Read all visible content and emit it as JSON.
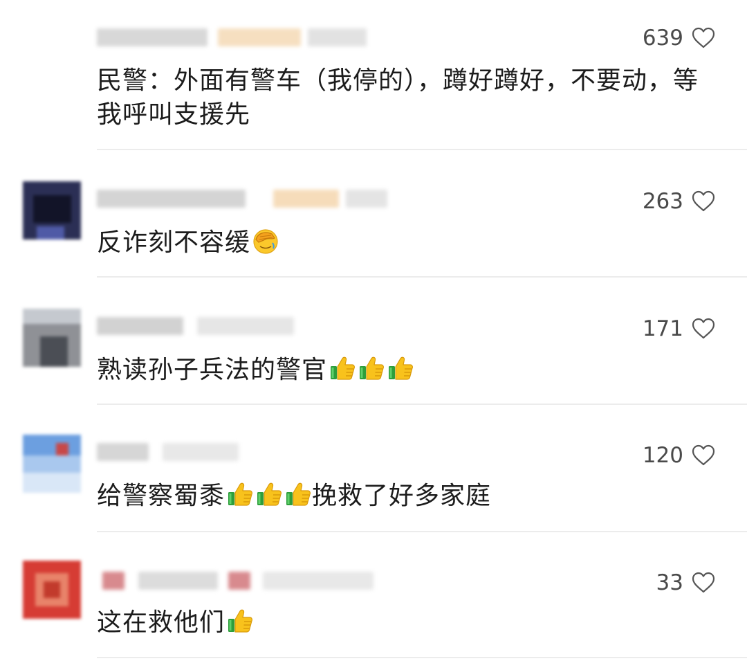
{
  "comments": [
    {
      "likes": "639",
      "text": "民警：外面有警车（我停的），蹲好蹲好，不要动，等我呼叫支援先",
      "emojis": []
    },
    {
      "likes": "263",
      "text": "反诈刻不容缓",
      "emojis": [
        "facepalm-emoji"
      ]
    },
    {
      "likes": "171",
      "text": "熟读孙子兵法的警官",
      "emojis": [
        "thumbs-up-emoji",
        "thumbs-up-emoji",
        "thumbs-up-emoji"
      ]
    },
    {
      "likes": "120",
      "text_before": "给警察蜀黍",
      "text_after": "挽救了好多家庭",
      "emojis": [
        "thumbs-up-emoji",
        "thumbs-up-emoji",
        "thumbs-up-emoji"
      ]
    },
    {
      "likes": "33",
      "text": "这在救他们",
      "emojis": [
        "thumbs-up-emoji"
      ]
    }
  ],
  "icons": {
    "like": "heart-outline-icon"
  },
  "colors": {
    "text": "#1c1c1c",
    "likes": "#4a4a4a",
    "divider": "#ececec"
  }
}
